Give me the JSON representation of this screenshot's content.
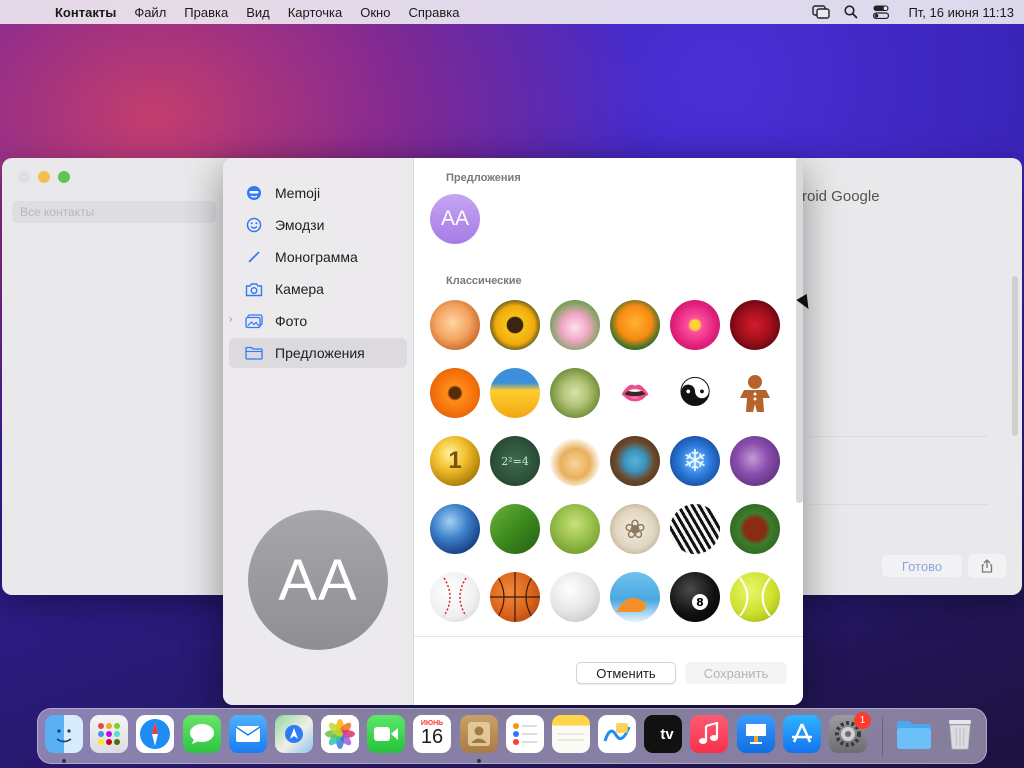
{
  "menubar": {
    "app_name": "Контакты",
    "items": [
      "Файл",
      "Правка",
      "Вид",
      "Карточка",
      "Окно",
      "Справка"
    ],
    "clock": "Пт, 16 июня  11:13"
  },
  "background_window": {
    "search_placeholder": "Все контакты",
    "right_title": "roid Google",
    "done_label": "Готово"
  },
  "sidebar": {
    "items": [
      {
        "label": "Memoji",
        "icon": "memoji-icon"
      },
      {
        "label": "Эмодзи",
        "icon": "emoji-icon"
      },
      {
        "label": "Монограмма",
        "icon": "pencil-icon"
      },
      {
        "label": "Камера",
        "icon": "camera-icon"
      },
      {
        "label": "Фото",
        "icon": "photos-icon"
      },
      {
        "label": "Предложения",
        "icon": "folder-icon"
      }
    ],
    "selected": "Предложения",
    "big_avatar_initials": "AA"
  },
  "content": {
    "suggestions_title": "Предложения",
    "suggestion_initials": "AA",
    "classic_title": "Классические",
    "classic_images": [
      "orange-rose",
      "sunflower",
      "lotus",
      "orange-poppy",
      "pink-zinnia",
      "red-rose",
      "orange-daisy",
      "yellow-flower",
      "dandelion",
      "lips",
      "yin-yang",
      "gingerbread-man",
      "gold-medal",
      "chalkboard",
      "fortune-cookie",
      "eggs-in-nest",
      "snowflake",
      "lightning",
      "earth",
      "green-leaf",
      "leaves",
      "sand-dollar",
      "zebra",
      "football",
      "baseball",
      "basketball",
      "golf-ball",
      "surfboard",
      "eight-ball",
      "tennis-ball"
    ],
    "cancel_label": "Отменить",
    "save_label": "Сохранить"
  },
  "dock": {
    "calendar_month": "ИЮНЬ",
    "calendar_day": "16",
    "settings_badge": "1",
    "tv_label": "tv"
  }
}
